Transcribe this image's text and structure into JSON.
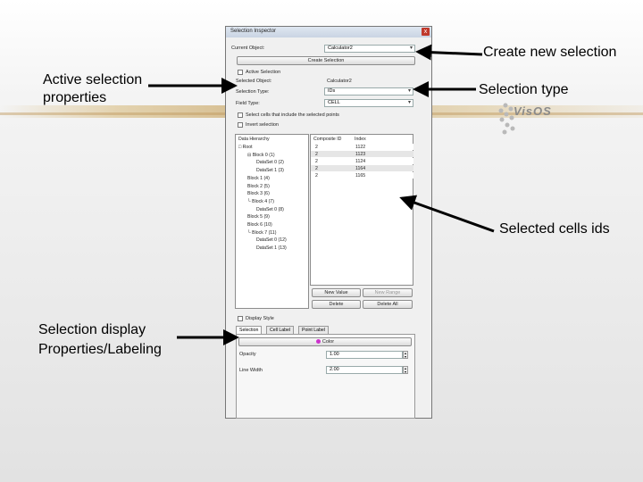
{
  "annotations": {
    "create_new_selection": "Create new selection",
    "active_selection_props_line1": "Active selection",
    "active_selection_props_line2": "properties",
    "selection_type": "Selection type",
    "selected_cells_ids": "Selected cells ids",
    "display_props_line1": "Selection display",
    "display_props_line2": "Properties/Labeling"
  },
  "logo": {
    "text": "VisOS"
  },
  "window": {
    "title": "Selection Inspector",
    "close_label": "x",
    "current_object_label": "Current Object:",
    "current_object_value": "Calculator2",
    "create_selection_label": "Create Selection",
    "active_selection_group": "Active Selection",
    "selected_object_label": "Selected Object:",
    "selected_object_value": "Calculator2",
    "selection_type_label": "Selection Type:",
    "selection_type_value": "IDs",
    "field_type_label": "Field Type:",
    "field_type_value": "CELL",
    "check_points_label": "Select cells that include the selected points",
    "check_inverse_label": "Invert selection",
    "tree_header": "Data Hierarchy",
    "tree_items": [
      "Root",
      "Block 0 (1)",
      "DataSet 0 (2)",
      "DataSet 1 (3)",
      "Block 1 (4)",
      "Block 2 (5)",
      "Block 3 (6)",
      "Block 4 (7)",
      "DataSet 0 (8)",
      "Block 5 (9)",
      "Block 6 (10)",
      "Block 7 (11)",
      "DataSet 0 (12)",
      "DataSet 1 (13)"
    ],
    "table_headers": [
      "Composite ID",
      "Index"
    ],
    "table_rows": [
      {
        "cid": "2",
        "index": "1122"
      },
      {
        "cid": "2",
        "index": "1123"
      },
      {
        "cid": "2",
        "index": "1124"
      },
      {
        "cid": "2",
        "index": "1164"
      },
      {
        "cid": "2",
        "index": "1165"
      }
    ],
    "new_value_label": "New Value",
    "new_range_label": "New Range",
    "delete_label": "Delete",
    "delete_all_label": "Delete All",
    "display_style_group": "Display Style",
    "tabs": [
      "Selection",
      "Cell Label",
      "Point Label"
    ],
    "color_button_label": "Color",
    "color_swatch": "#cc33cc",
    "opacity_label": "Opacity",
    "opacity_value": "1.00",
    "line_width_label": "Line Width",
    "line_width_value": "2.00"
  }
}
